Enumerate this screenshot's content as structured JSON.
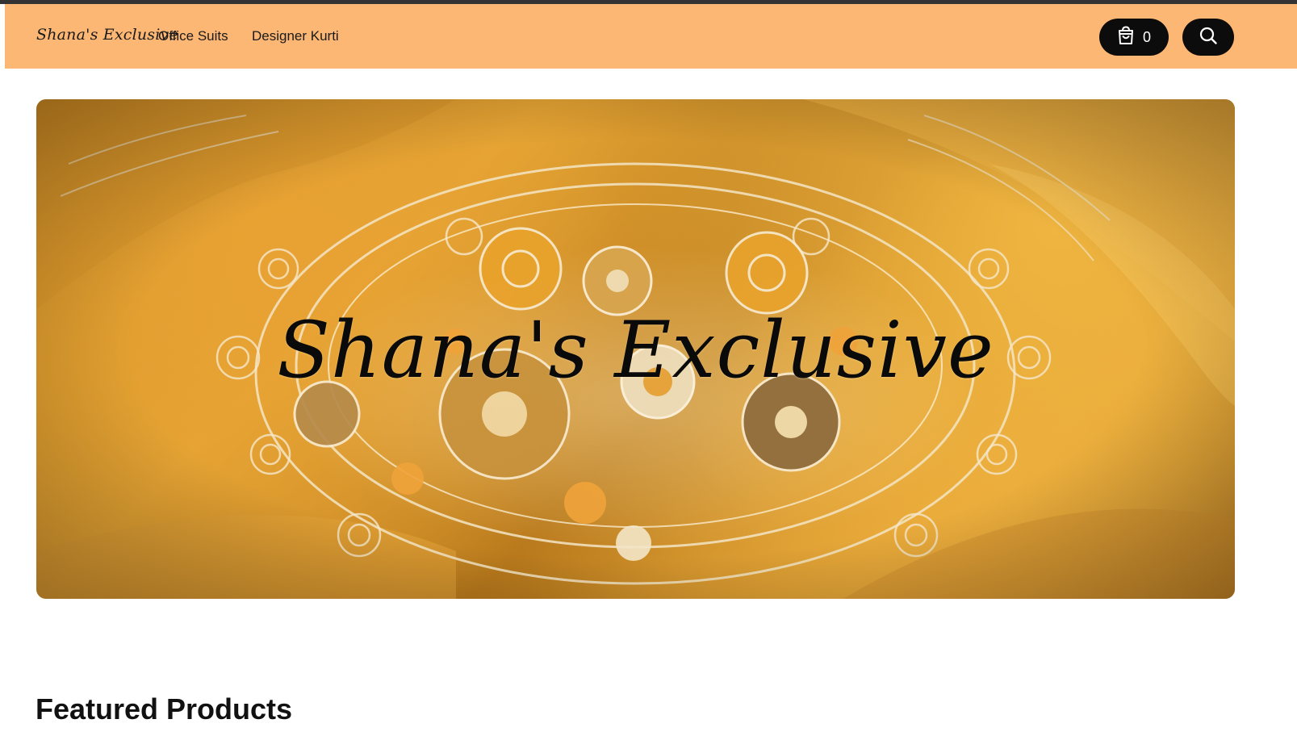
{
  "header": {
    "logo": "Shana's Exclusive",
    "nav": [
      {
        "label": "Office Suits"
      },
      {
        "label": "Designer Kurti"
      }
    ],
    "cart": {
      "icon": "shopping-bag-icon",
      "count": "0"
    },
    "search": {
      "icon": "search-icon"
    }
  },
  "hero": {
    "title": "Shana's Exclusive"
  },
  "main": {
    "section_title": "Featured Products"
  },
  "colors": {
    "header_bg": "#fdb774",
    "button_bg": "#0c0c0c",
    "topbar": "#333333"
  }
}
